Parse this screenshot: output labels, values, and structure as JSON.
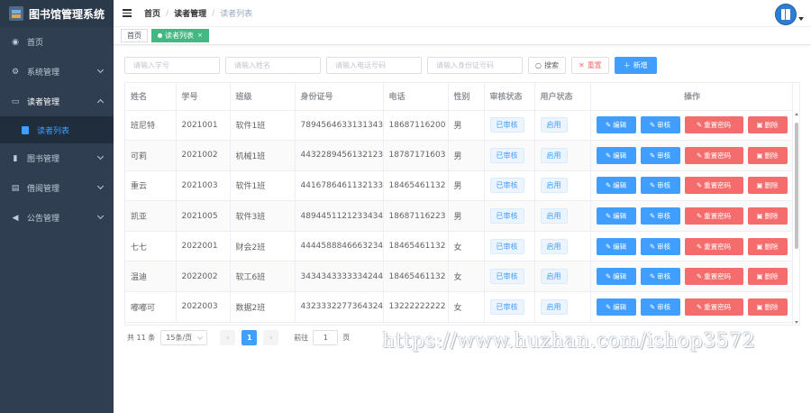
{
  "app": {
    "title": "图书馆管理系统"
  },
  "sidebar": {
    "items": [
      {
        "label": "首页",
        "icon": "dashboard-icon"
      },
      {
        "label": "系统管理",
        "icon": "gear-icon"
      },
      {
        "label": "读者管理",
        "icon": "reader-card-icon",
        "expanded": true,
        "children": [
          {
            "label": "读者列表",
            "icon": "document-icon"
          }
        ]
      },
      {
        "label": "图书管理",
        "icon": "books-icon"
      },
      {
        "label": "借阅管理",
        "icon": "borrow-icon"
      },
      {
        "label": "公告管理",
        "icon": "megaphone-icon"
      }
    ]
  },
  "header": {
    "breadcrumb": [
      "首页",
      "读者管理",
      "读者列表"
    ],
    "separator": "/"
  },
  "tags": [
    {
      "label": "首页"
    },
    {
      "label": "读者列表"
    }
  ],
  "search": {
    "student_no": "请输入学号",
    "name": "请输入姓名",
    "phone": "请输入电话号码",
    "id_card": "请输入身份证号码",
    "search_label": "搜索",
    "reset_label": "重置",
    "add_label": "新增"
  },
  "table": {
    "headers": [
      "姓名",
      "学号",
      "班级",
      "身份证号",
      "电话",
      "性别",
      "审核状态",
      "用户状态",
      "操作"
    ],
    "op_labels": {
      "edit": "编辑",
      "audit": "审核",
      "reset_pwd": "重置密码",
      "delete": "删除"
    },
    "rows": [
      {
        "name": "班尼特",
        "no": "2021001",
        "class": "软件1班",
        "id": "789456463313134343",
        "phone": "18687116200",
        "gender": "男",
        "audit": "已审核",
        "status": "启用"
      },
      {
        "name": "可莉",
        "no": "2021002",
        "class": "机械1班",
        "id": "443228945613212313",
        "phone": "18787171603",
        "gender": "男",
        "audit": "已审核",
        "status": "启用"
      },
      {
        "name": "重云",
        "no": "2021003",
        "class": "软件1班",
        "id": "441678646113213331",
        "phone": "18465461132",
        "gender": "男",
        "audit": "已审核",
        "status": "启用"
      },
      {
        "name": "凯亚",
        "no": "2021005",
        "class": "软件3班",
        "id": "489445112123343424",
        "phone": "18687116223",
        "gender": "男",
        "audit": "已审核",
        "status": "启用"
      },
      {
        "name": "七七",
        "no": "2022001",
        "class": "财会2班",
        "id": "444458884666323451",
        "phone": "18465461132",
        "gender": "女",
        "audit": "已审核",
        "status": "启用"
      },
      {
        "name": "温迪",
        "no": "2022002",
        "class": "软工6班",
        "id": "343434333333424445",
        "phone": "18465461132",
        "gender": "女",
        "audit": "已审核",
        "status": "启用"
      },
      {
        "name": "嘟嘟可",
        "no": "2022003",
        "class": "数据2班",
        "id": "432333227736432441",
        "phone": "13222222222",
        "gender": "女",
        "audit": "已审核",
        "status": "启用"
      }
    ]
  },
  "pagination": {
    "total_text": "共 11 条",
    "page_size": "15条/页",
    "current_page": "1",
    "goto_prefix": "前往",
    "goto_value": "1",
    "goto_suffix": "页"
  },
  "watermark": "https://www.huzhan.com/ishop3572",
  "colors": {
    "primary": "#409eff",
    "danger": "#f56c6c",
    "sidebar": "#2f3e51",
    "tag_active": "#42b983"
  }
}
